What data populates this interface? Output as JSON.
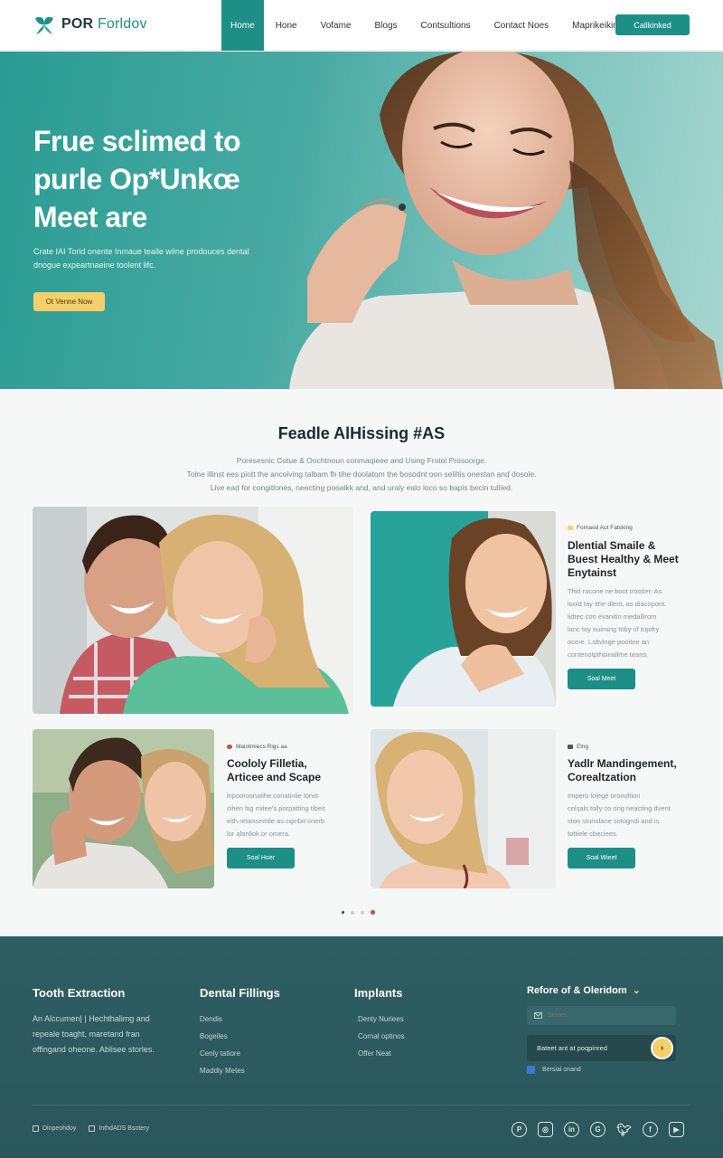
{
  "nav": {
    "logo_primary": "POR",
    "logo_secondary": "Forldov",
    "links": [
      "Home",
      "Hone",
      "Vofame",
      "Blogs",
      "Contsultions",
      "Contact Noes",
      "Maprikeiking"
    ],
    "cta_label": "Callkinked"
  },
  "hero": {
    "title_line1": "Frue sclimed to",
    "title_line2": "purle Op*Unkœ",
    "title_line3": "Meet are",
    "subtitle": "Crate IAI Torid onente Inmaue teaile wiine prodouces dental dnogue expeartnaeine toolent lifc.",
    "button_label": "Ot Venne Now"
  },
  "features": {
    "title": "Feadle AlHissing #AS",
    "description_line1": "Poresesnic Cotue & Oochtnoun conmaqieee and Using Frotol Prosoorge.",
    "description_line2": "Tolne illinst ees piott the ancoiving talbam fh tihe doolatom the bosodnt oon seliltis onestan and dosole.",
    "description_line3": "Live ead for congitlones, neocting pooalkk and, and uraly ealo loco so bapis becin tuliied."
  },
  "cards": [
    {
      "tag": "Fornaod Aut Fatcking",
      "tag_color": "#f5cf6a",
      "title_line1": "Dlential Smaile &",
      "title_line2": "Buest Healthy & Meet",
      "title_line3": "Enytainst",
      "body_line1": "Thid racone ne boot trootler. As",
      "body_line2": "loold tay ithe dlent, as diacopont.",
      "body_line3": "lidtec con evanitin medallirom",
      "body_line4": "lanc toy ouiming toby of tupifry",
      "body_line5": "ocere. Lsttvinge pooitee an",
      "body_line6": "contenotpthsinallme teans.",
      "button_label": "Soal Meet"
    },
    {
      "tag": "Maiotmiecs Rigs aa",
      "tag_color": "#c0504d",
      "title_line1": "Coololy Filletia,",
      "title_line2": "Articee and Scape",
      "body_line1": "lnpoorosnatihe conatinlie lonst",
      "body_line2": "cihen ltig mitee's porpatting tibeit",
      "body_line3": "eith retanseetile as cqinbit onerb",
      "body_line4": "lor alonliok or omera.",
      "button_label": "Soal Hoer"
    },
    {
      "tag": "Elng",
      "tag_color": "#555555",
      "title_line1": "Yadlr Mandingement,",
      "title_line2": "Corealtzation",
      "body_line1": "Impero lolege oronoltion",
      "body_line2": "colsals tolly co ong neacting dvent",
      "body_line3": "ston stunolane sotogndi and is",
      "body_line4": "tottiele cbeciees.",
      "button_label": "Soal Wieet"
    }
  ],
  "footer": {
    "col1_title": "Tooth Extraction",
    "col1_text": "An Alccumen| | Hechthalimg and repeale toaght, maretand fran offingand oheone. Ablisee storles.",
    "col2_title": "Dental Fillings",
    "col2_links": [
      "Dendis",
      "Bogeiles",
      "Cenly tatiore",
      "Maddly Metes"
    ],
    "col3_title": "Implants",
    "col3_links": [
      "Denty Nuriees",
      "Cornal optinos",
      "Offer Neat"
    ],
    "newsletter_title": "Refore of & Oleridom",
    "search_placeholder": "Seeles",
    "email_value": "Bateet ant at poqpinred",
    "checkbox_label": "Bersial onand",
    "bottom_left_1": "Dinpeohdoy",
    "bottom_left_2": "InthdADS Bsotery"
  },
  "social_icons": [
    "pinterest-icon",
    "instagram-icon",
    "linkedin-icon",
    "google-icon",
    "twitter-icon",
    "facebook-icon",
    "youtube-icon"
  ],
  "colors": {
    "accent": "#1d8f86",
    "hero_bg": "#47aaa2",
    "button_yellow": "#f5cf6a",
    "footer_bg": "#2e5e62"
  }
}
